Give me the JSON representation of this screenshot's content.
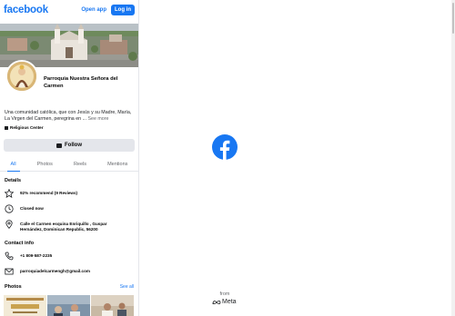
{
  "header": {
    "logo": "facebook",
    "open_app": "Open app",
    "login": "Log in"
  },
  "page": {
    "name": "Parroquia Nuestra Señora del Carmen",
    "description": "Una comunidad católica, que con Jesús y su Madre, María, La Virgen del Carmen, peregrina en ...",
    "see_more": "See more",
    "category": "Religious Center",
    "follow": "Follow"
  },
  "tabs": [
    {
      "label": "All",
      "active": true
    },
    {
      "label": "Photos",
      "active": false
    },
    {
      "label": "Reels",
      "active": false
    },
    {
      "label": "Mentions",
      "active": false
    }
  ],
  "details": {
    "title": "Details",
    "recommend": "92% recommend (9 Reviews)",
    "status": "Closed now",
    "address": "Calle el Carmen esquina Enriquillo , Guspar Hernández, Dominican Republic, 56200"
  },
  "contact": {
    "title": "Contact info",
    "phone": "+1 809-587-2235",
    "email": "parroquiadelcarmengh@gmail.com"
  },
  "photos": {
    "title": "Photos",
    "see_all": "See all"
  },
  "branding": {
    "from": "from",
    "meta": "Meta"
  },
  "icons": {
    "recommend": "star-icon",
    "status": "clock-icon",
    "address": "location-pin-icon",
    "phone": "phone-icon",
    "email": "mail-icon"
  },
  "colors": {
    "brand_blue": "#1877f2",
    "button_gray": "#e4e6eb",
    "text_secondary": "#65676b"
  }
}
